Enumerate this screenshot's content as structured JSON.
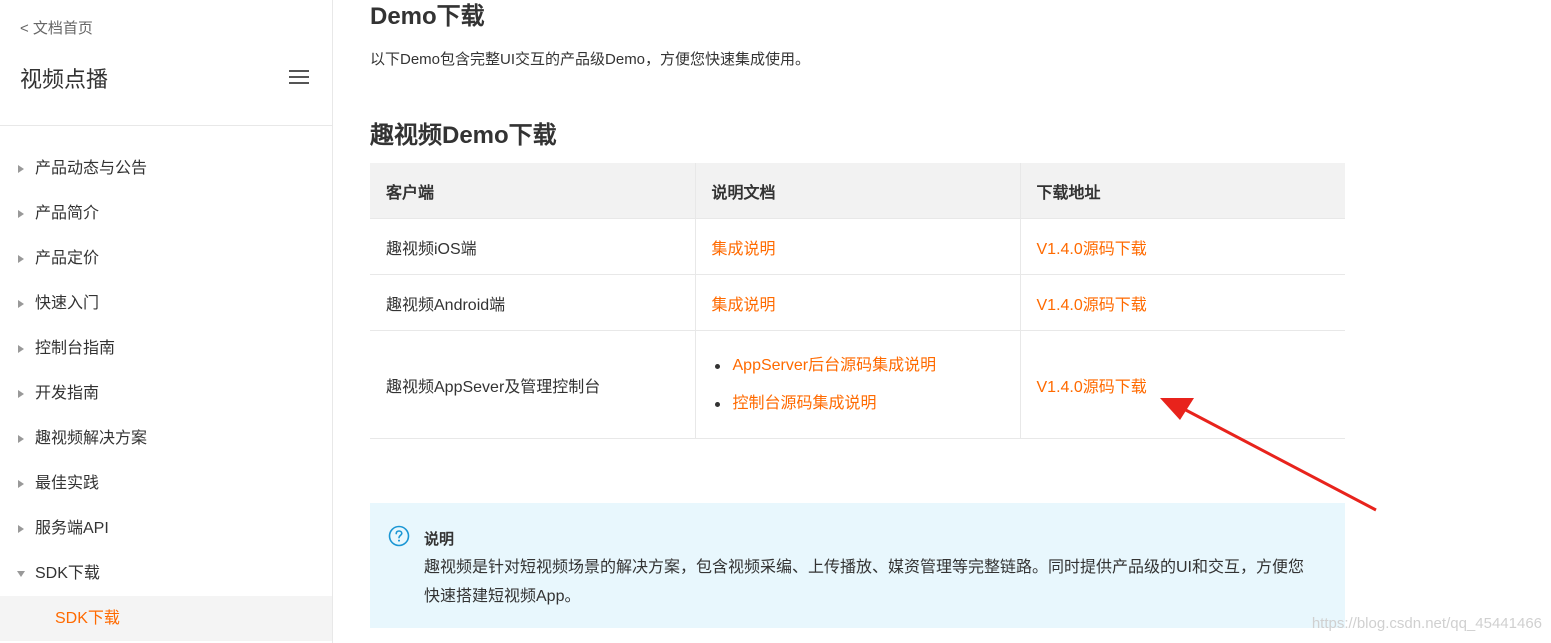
{
  "sidebar": {
    "back_label": "< 文档首页",
    "product_title": "视频点播",
    "menu_icon": "menu-icon",
    "items": [
      {
        "label": "产品动态与公告"
      },
      {
        "label": "产品简介"
      },
      {
        "label": "产品定价"
      },
      {
        "label": "快速入门"
      },
      {
        "label": "控制台指南"
      },
      {
        "label": "开发指南"
      },
      {
        "label": "趣视频解决方案"
      },
      {
        "label": "最佳实践"
      },
      {
        "label": "服务端API"
      },
      {
        "label": "SDK下载",
        "expanded": true
      }
    ],
    "active_sub": "SDK下载"
  },
  "main": {
    "title": "Demo下载",
    "intro": "以下Demo包含完整UI交互的产品级Demo，方便您快速集成使用。",
    "section_title": "趣视频Demo下载",
    "table": {
      "headers": [
        "客户端",
        "说明文档",
        "下载地址"
      ],
      "rows": [
        {
          "client": "趣视频iOS端",
          "doc": "集成说明",
          "download": "V1.4.0源码下载"
        },
        {
          "client": "趣视频Android端",
          "doc": "集成说明",
          "download": "V1.4.0源码下载"
        },
        {
          "client": "趣视频AppSever及管理控制台",
          "docs": [
            "AppServer后台源码集成说明",
            "控制台源码集成说明"
          ],
          "download": "V1.4.0源码下载"
        }
      ]
    },
    "note": {
      "icon": "question-circle-icon",
      "title": "说明",
      "text": "趣视频是针对短视频场景的解决方案，包含视频采编、上传播放、媒资管理等完整链路。同时提供产品级的UI和交互，方便您快速搭建短视频App。"
    }
  },
  "annotation": {
    "icon": "red-arrow-icon",
    "color": "#e8231c"
  },
  "watermark": "https://blog.csdn.net/qq_45441466",
  "colors": {
    "accent": "#ff6a00",
    "note_bg": "#e8f7fd",
    "header_bg": "#f2f2f2"
  }
}
